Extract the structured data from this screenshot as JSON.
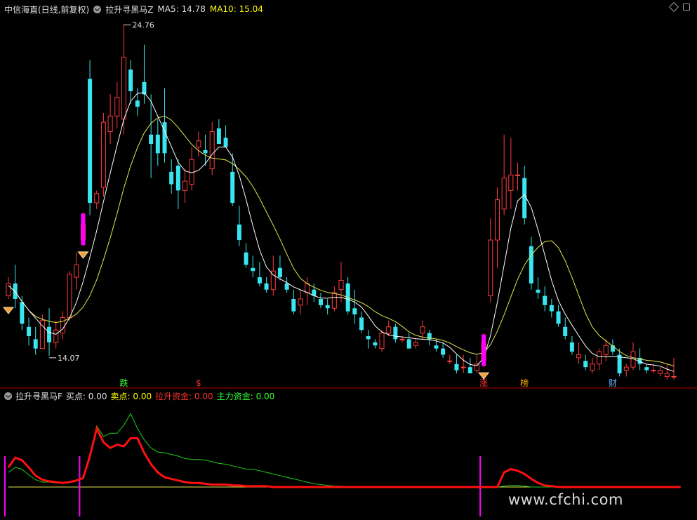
{
  "header": {
    "stock_name": "中信海直(日线,前复权)",
    "indicator_name": "拉升寻黑马Z",
    "ma5_label": "MA5:",
    "ma5_value": "14.78",
    "ma10_label": "MA10:",
    "ma10_value": "15.04"
  },
  "sub_header": {
    "indicator_name": "拉升寻黑马F",
    "buy_label": "买点:",
    "buy_value": "0.00",
    "sell_label": "卖点:",
    "sell_value": "0.00",
    "rise_label": "拉升资金:",
    "rise_value": "0.00",
    "main_label": "主力资金:",
    "main_value": "0.00"
  },
  "watermark": "www.cfchi.com",
  "colors": {
    "up": "#ff3c3c",
    "down": "#39e5ef",
    "ma5": "#ffffff",
    "ma10": "#e6e64e",
    "signal_bar": "#ff00ff",
    "rise_fund": "#ff1010",
    "main_fund": "#19d019",
    "baseline": "#e6e64e",
    "divider": "#b00000"
  },
  "chart_data": [
    {
      "type": "candlestick",
      "name": "price",
      "price_range": [
        13.5,
        25.0
      ],
      "annotations": [
        {
          "text": "24.76",
          "index": 17
        },
        {
          "text": "14.07",
          "index": 6
        }
      ],
      "event_labels": [
        {
          "text": "跌",
          "index": 17,
          "color": "#30ff30"
        },
        {
          "text": "$",
          "index": 28,
          "color": "#ff3030"
        },
        {
          "text": "涨",
          "index": 70,
          "color": "#ff3030"
        },
        {
          "text": "榜",
          "index": 76,
          "color": "#ffb000"
        },
        {
          "text": "财",
          "index": 89,
          "color": "#66b3ff"
        }
      ],
      "signal_indices": [
        0,
        11,
        70
      ],
      "ohlc": [
        [
          16.0,
          16.6,
          15.9,
          16.4
        ],
        [
          16.4,
          17.0,
          15.6,
          15.9
        ],
        [
          15.8,
          16.0,
          14.9,
          15.1
        ],
        [
          15.0,
          15.3,
          14.4,
          14.7
        ],
        [
          14.6,
          15.0,
          14.1,
          14.3
        ],
        [
          14.3,
          15.4,
          14.3,
          15.2
        ],
        [
          15.0,
          15.6,
          14.07,
          14.5
        ],
        [
          14.5,
          15.2,
          14.3,
          14.9
        ],
        [
          14.8,
          15.5,
          14.6,
          15.3
        ],
        [
          15.3,
          16.8,
          15.2,
          16.7
        ],
        [
          16.6,
          17.4,
          16.2,
          17.0
        ],
        [
          17.8,
          18.7,
          17.6,
          18.3
        ],
        [
          23.0,
          23.6,
          18.6,
          19.0
        ],
        [
          19.0,
          19.4,
          18.8,
          19.3
        ],
        [
          19.5,
          21.9,
          19.2,
          21.6
        ],
        [
          21.3,
          22.5,
          20.9,
          21.8
        ],
        [
          21.8,
          22.9,
          21.4,
          22.4
        ],
        [
          21.7,
          24.76,
          21.2,
          23.7
        ],
        [
          23.3,
          23.6,
          22.2,
          22.6
        ],
        [
          22.3,
          22.7,
          21.8,
          22.1
        ],
        [
          22.9,
          24.1,
          22.2,
          22.5
        ],
        [
          21.2,
          22.5,
          19.8,
          20.9
        ],
        [
          21.2,
          21.7,
          20.2,
          20.6
        ],
        [
          21.6,
          22.7,
          20.3,
          20.6
        ],
        [
          20.0,
          20.4,
          19.3,
          19.6
        ],
        [
          20.2,
          20.4,
          18.8,
          19.4
        ],
        [
          19.4,
          20.1,
          19.0,
          19.7
        ],
        [
          19.6,
          20.8,
          19.4,
          20.4
        ],
        [
          20.8,
          21.3,
          20.5,
          21.0
        ],
        [
          20.7,
          21.2,
          20.2,
          20.6
        ],
        [
          20.1,
          21.6,
          19.9,
          21.3
        ],
        [
          21.4,
          21.7,
          20.9,
          20.9
        ],
        [
          21.1,
          21.5,
          20.9,
          20.8
        ],
        [
          20.0,
          20.6,
          18.9,
          19.0
        ],
        [
          18.3,
          18.9,
          17.6,
          17.8
        ],
        [
          17.4,
          17.7,
          16.9,
          17.0
        ],
        [
          16.9,
          17.3,
          16.6,
          16.8
        ],
        [
          16.6,
          17.1,
          16.3,
          16.4
        ],
        [
          16.4,
          16.6,
          16.1,
          16.2
        ],
        [
          16.2,
          17.3,
          16.0,
          16.8
        ],
        [
          16.9,
          17.3,
          16.5,
          16.6
        ],
        [
          16.4,
          16.6,
          16.1,
          16.2
        ],
        [
          15.9,
          16.2,
          15.4,
          15.5
        ],
        [
          15.7,
          16.2,
          15.4,
          15.9
        ],
        [
          16.1,
          16.6,
          15.7,
          16.4
        ],
        [
          16.2,
          16.4,
          15.8,
          16.0
        ],
        [
          15.9,
          16.1,
          15.6,
          15.7
        ],
        [
          15.7,
          15.9,
          15.4,
          15.6
        ],
        [
          15.6,
          16.3,
          15.5,
          16.1
        ],
        [
          16.2,
          17.1,
          15.8,
          16.5
        ],
        [
          16.4,
          16.6,
          15.4,
          15.5
        ],
        [
          15.6,
          16.2,
          15.1,
          15.4
        ],
        [
          15.3,
          15.5,
          14.8,
          14.9
        ],
        [
          14.7,
          14.9,
          14.3,
          14.6
        ],
        [
          14.5,
          14.6,
          14.3,
          14.4
        ],
        [
          14.3,
          14.9,
          14.2,
          14.8
        ],
        [
          14.8,
          15.2,
          14.7,
          15.0
        ],
        [
          15.0,
          15.1,
          14.5,
          14.6
        ],
        [
          14.6,
          14.7,
          14.5,
          14.6
        ],
        [
          14.6,
          14.8,
          14.4,
          14.3
        ],
        [
          14.4,
          14.6,
          14.3,
          14.5
        ],
        [
          14.8,
          15.2,
          14.6,
          15.0
        ],
        [
          14.8,
          14.9,
          14.4,
          14.6
        ],
        [
          14.4,
          14.6,
          14.2,
          14.3
        ],
        [
          14.3,
          14.5,
          14.0,
          14.1
        ],
        [
          13.9,
          14.1,
          13.8,
          13.9
        ],
        [
          13.8,
          14.1,
          13.5,
          13.6
        ],
        [
          13.7,
          14.1,
          13.5,
          13.7
        ],
        [
          13.7,
          14.0,
          13.5,
          13.5
        ],
        [
          13.6,
          14.1,
          13.5,
          13.8
        ],
        [
          13.9,
          14.8,
          13.7,
          14.5
        ],
        [
          16.0,
          18.5,
          15.8,
          17.8
        ],
        [
          17.8,
          19.5,
          16.9,
          19.1
        ],
        [
          18.8,
          21.2,
          18.6,
          19.8
        ],
        [
          19.4,
          21.1,
          18.8,
          19.9
        ],
        [
          19.9,
          20.3,
          19.4,
          19.9
        ],
        [
          19.8,
          20.2,
          18.3,
          18.5
        ],
        [
          17.6,
          17.9,
          16.2,
          16.4
        ],
        [
          16.2,
          16.6,
          15.9,
          16.1
        ],
        [
          16.0,
          16.3,
          15.5,
          15.7
        ],
        [
          15.7,
          15.9,
          15.3,
          15.5
        ],
        [
          15.5,
          15.7,
          15.0,
          15.1
        ],
        [
          15.0,
          15.3,
          14.6,
          14.7
        ],
        [
          14.5,
          14.7,
          14.1,
          14.2
        ],
        [
          14.0,
          14.5,
          13.8,
          14.1
        ],
        [
          13.9,
          14.1,
          13.6,
          13.7
        ],
        [
          13.6,
          14.0,
          13.5,
          13.8
        ],
        [
          13.8,
          14.3,
          13.6,
          14.2
        ],
        [
          14.1,
          14.6,
          13.9,
          14.4
        ],
        [
          14.4,
          14.6,
          14.1,
          14.2
        ],
        [
          14.1,
          14.3,
          13.4,
          13.5
        ],
        [
          13.6,
          13.8,
          13.4,
          13.7
        ],
        [
          13.7,
          14.5,
          13.6,
          14.2
        ],
        [
          14.0,
          14.3,
          13.6,
          13.8
        ],
        [
          13.7,
          13.8,
          13.5,
          13.6
        ],
        [
          13.6,
          13.8,
          13.5,
          13.6
        ],
        [
          13.5,
          13.7,
          13.4,
          13.6
        ],
        [
          13.4,
          13.8,
          13.3,
          13.5
        ],
        [
          13.4,
          14.0,
          13.3,
          13.4
        ]
      ]
    },
    {
      "type": "line",
      "name": "indicator",
      "y_range": [
        0,
        100
      ],
      "signal_indices": [
        0,
        11,
        70
      ],
      "series": [
        {
          "key": "main_fund",
          "values": [
            18,
            24,
            22,
            15,
            9,
            6,
            6,
            5,
            5,
            7,
            8,
            10,
            35,
            75,
            62,
            66,
            66,
            76,
            90,
            72,
            58,
            48,
            43,
            42,
            40,
            38,
            35,
            34,
            34,
            33,
            31,
            29,
            28,
            26,
            24,
            22,
            22,
            20,
            18,
            16,
            14,
            12,
            10,
            8,
            6,
            4,
            3,
            2,
            1,
            1,
            0,
            0,
            0,
            0,
            0,
            0,
            0,
            0,
            0,
            0,
            0,
            0,
            0,
            0,
            0,
            0,
            0,
            0,
            0,
            0,
            0,
            0,
            0,
            1,
            2,
            2,
            1,
            0,
            0,
            0,
            0,
            0,
            0,
            0,
            0,
            0,
            0,
            0,
            0,
            0,
            0,
            0,
            0,
            0,
            0,
            0,
            0,
            0,
            0,
            0
          ]
        },
        {
          "key": "rise_fund",
          "values": [
            24,
            36,
            33,
            24,
            14,
            9,
            7,
            6,
            5,
            6,
            8,
            11,
            38,
            72,
            55,
            48,
            52,
            50,
            60,
            60,
            42,
            28,
            18,
            12,
            10,
            8,
            6,
            5,
            5,
            4,
            3,
            3,
            3,
            2,
            2,
            1,
            1,
            1,
            1,
            0,
            0,
            0,
            0,
            0,
            0,
            0,
            0,
            0,
            0,
            0,
            0,
            0,
            0,
            0,
            0,
            0,
            0,
            0,
            0,
            0,
            0,
            0,
            0,
            0,
            0,
            0,
            0,
            0,
            0,
            0,
            0,
            0,
            0,
            18,
            22,
            20,
            16,
            10,
            5,
            2,
            1,
            0,
            0,
            0,
            0,
            0,
            0,
            0,
            0,
            0,
            0,
            0,
            0,
            0,
            0,
            0,
            0,
            0,
            0,
            0
          ]
        }
      ]
    }
  ]
}
